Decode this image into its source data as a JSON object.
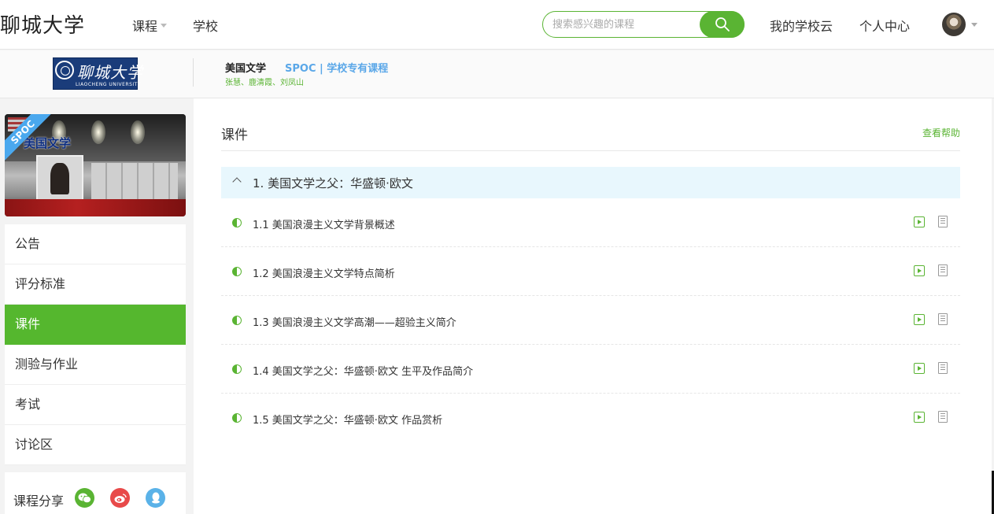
{
  "topbar": {
    "brand": "聊城大学",
    "nav_courses": "课程",
    "nav_school": "学校",
    "search_placeholder": "搜索感兴趣的课程",
    "nav_cloud": "我的学校云",
    "nav_personal": "个人中心"
  },
  "course_header": {
    "logo_cn": "聊城大学",
    "logo_en": "LIAOCHENG UNIVERSITY",
    "title": "美国文学",
    "spoc_tag": "SPOC | 学校专有课程",
    "teachers": "张慧、鹿清霞、刘凤山"
  },
  "cover": {
    "title": "美国文学",
    "ribbon": "SPOC"
  },
  "sidebar": {
    "items": [
      {
        "label": "公告"
      },
      {
        "label": "评分标准"
      },
      {
        "label": "课件"
      },
      {
        "label": "测验与作业"
      },
      {
        "label": "考试"
      },
      {
        "label": "讨论区"
      }
    ],
    "active": "课件",
    "share_label": "课程分享"
  },
  "main": {
    "section_title": "课件",
    "help_link": "查看帮助",
    "chapter_title": "1. 美国文学之父：华盛顿·欧文",
    "lessons": [
      {
        "title": "1.1 美国浪漫主义文学背景概述"
      },
      {
        "title": "1.2 美国浪漫主义文学特点简析"
      },
      {
        "title": "1.3 美国浪漫主义文学高潮——超验主义简介"
      },
      {
        "title": "1.4 美国文学之父：华盛顿·欧文 生平及作品简介"
      },
      {
        "title": "1.5 美国文学之父：华盛顿·欧文 作品赏析"
      }
    ]
  },
  "colors": {
    "accent_green": "#55b72e",
    "spoc_blue": "#5aa7e8",
    "chapter_bg": "#e8f7fd"
  }
}
